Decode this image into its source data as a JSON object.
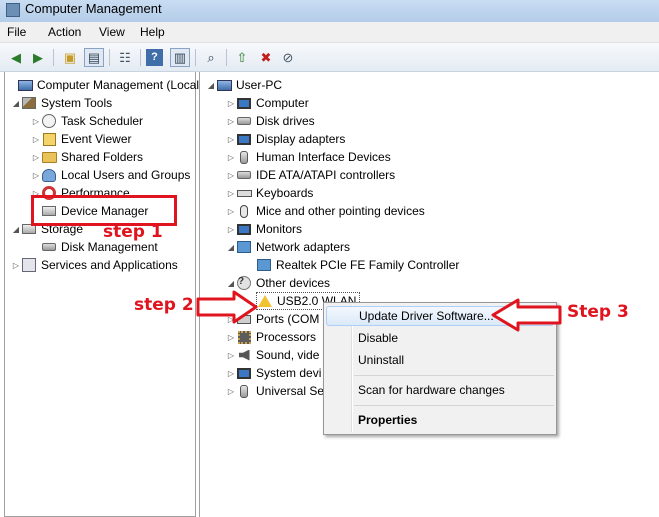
{
  "window": {
    "title": "Computer Management"
  },
  "menu": [
    "File",
    "Action",
    "View",
    "Help"
  ],
  "toolbar_icons": [
    "back-arrow-icon",
    "forward-arrow-icon",
    "up-folder-icon",
    "show-tree-icon",
    "properties-icon",
    "help-icon",
    "show-action-pane-icon",
    "scan-hardware-icon",
    "update-driver-icon",
    "uninstall-icon",
    "disable-icon"
  ],
  "left_tree": {
    "root": "Computer Management (Local",
    "system_tools": "System Tools",
    "items": [
      "Task Scheduler",
      "Event Viewer",
      "Shared Folders",
      "Local Users and Groups",
      "Performance",
      "Device Manager"
    ],
    "storage": "Storage",
    "disk_management": "Disk Management",
    "services": "Services and Applications"
  },
  "right_tree": {
    "root": "User-PC",
    "categories": [
      "Computer",
      "Disk drives",
      "Display adapters",
      "Human Interface Devices",
      "IDE ATA/ATAPI controllers",
      "Keyboards",
      "Mice and other pointing devices",
      "Monitors",
      "Network adapters"
    ],
    "network_child": "Realtek PCIe FE Family Controller",
    "other_devices": "Other devices",
    "usb_wlan": "USB2.0 WLAN",
    "below": [
      "Ports (COM",
      "Processors",
      "Sound, vide",
      "System devi",
      "Universal Se"
    ]
  },
  "context_menu": {
    "update": "Update Driver Software...",
    "disable": "Disable",
    "uninstall": "Uninstall",
    "scan": "Scan for hardware changes",
    "properties": "Properties"
  },
  "annotations": {
    "step1": "step 1",
    "step2": "step 2",
    "step3": "Step 3"
  },
  "colors": {
    "annotation_red": "#e0141e",
    "highlight_blue": "#dbe9f8"
  }
}
